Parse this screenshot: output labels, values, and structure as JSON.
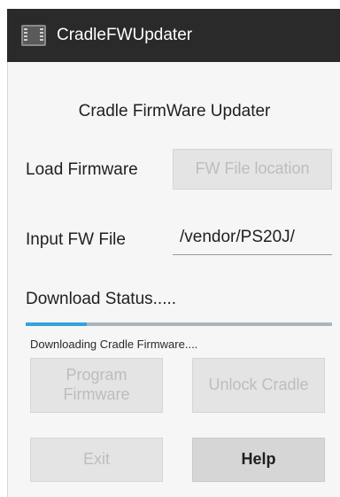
{
  "app": {
    "title": "CradleFWUpdater",
    "icon": "chip-icon"
  },
  "main": {
    "heading": "Cradle FirmWare Updater",
    "load_firmware_label": "Load Firmware",
    "fw_location_button": "FW File location",
    "input_fw_label": "Input FW File",
    "input_fw_value": "/vendor/PS20J/",
    "download_status_label": "Download Status.....",
    "progress_fraction": 0.2,
    "status_message": "Downloading  Cradle Firmware....",
    "program_button": "Program Firmware",
    "unlock_button": "Unlock Cradle",
    "exit_button": "Exit",
    "help_button": "Help"
  },
  "colors": {
    "titlebar": "#2a2a2a",
    "progress_fill": "#33a3db",
    "progress_track": "#a9b6bf",
    "disabled_text": "#bdbdbd"
  }
}
